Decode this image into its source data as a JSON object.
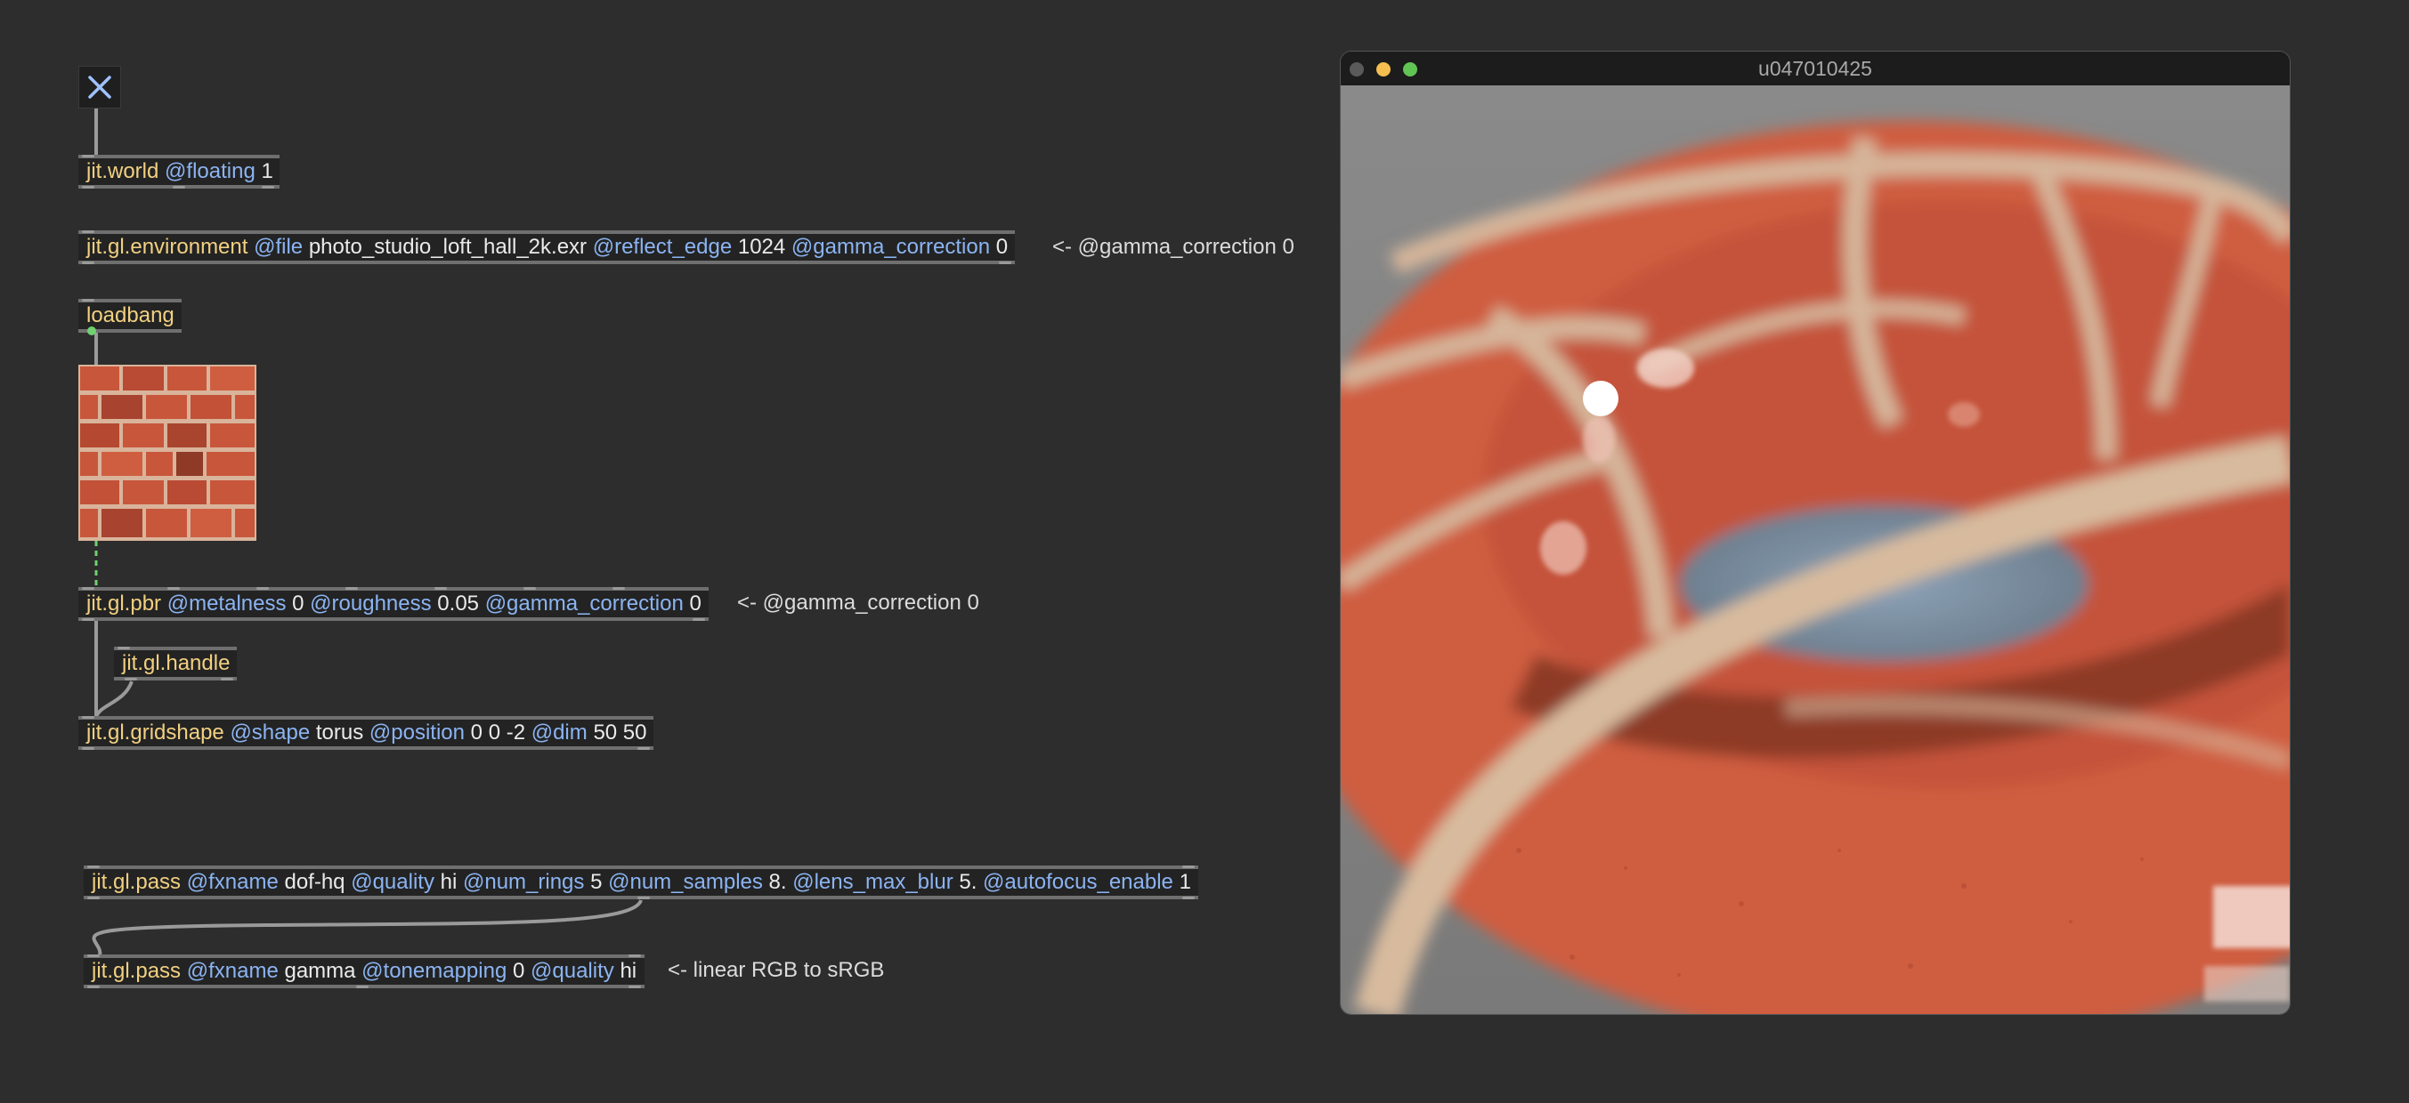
{
  "patcher": {
    "toggle_icon": "close-x-icon",
    "world": {
      "cls": "jit.world",
      "attr1": "@floating",
      "val1": "1"
    },
    "environment": {
      "cls": "jit.gl.environment",
      "attr1": "@file",
      "val1": "photo_studio_loft_hall_2k.exr",
      "attr2": "@reflect_edge",
      "val2": "1024",
      "attr3": "@gamma_correction",
      "val3": "0"
    },
    "environment_comment": "<- @gamma_correction 0",
    "loadbang": {
      "cls": "loadbang"
    },
    "texture_image": "brick-texture-image",
    "pbr": {
      "cls": "jit.gl.pbr",
      "attr1": "@metalness",
      "val1": "0",
      "attr2": "@roughness",
      "val2": "0.05",
      "attr3": "@gamma_correction",
      "val3": "0"
    },
    "pbr_comment": "<- @gamma_correction 0",
    "handle": {
      "cls": "jit.gl.handle"
    },
    "gridshape": {
      "cls": "jit.gl.gridshape",
      "attr1": "@shape",
      "val1": "torus",
      "attr2": "@position",
      "val2": "0 0 -2",
      "attr3": "@dim",
      "val3": "50 50"
    },
    "pass_dof": {
      "cls": "jit.gl.pass",
      "attr1": "@fxname",
      "val1": "dof-hq",
      "attr2": "@quality",
      "val2": "hi",
      "attr3": "@num_rings",
      "val3": "5",
      "attr4": "@num_samples",
      "val4": "8.",
      "attr5": "@lens_max_blur",
      "val5": "5.",
      "attr6": "@autofocus_enable",
      "val6": "1"
    },
    "pass_gamma": {
      "cls": "jit.gl.pass",
      "attr1": "@fxname",
      "val1": "gamma",
      "attr2": "@tonemapping",
      "val2": "0",
      "attr3": "@quality",
      "val3": "hi"
    },
    "pass_gamma_comment": "<- linear RGB to sRGB"
  },
  "render_window": {
    "title": "u047010425",
    "traffic_colors": [
      "#5a5a5a",
      "#f5bf4f",
      "#61c554"
    ],
    "render_content": "red-brick-torus-render"
  },
  "colors": {
    "background": "#2d2d2d",
    "object_class": "#f2d081",
    "attribute": "#8bb4f2",
    "value": "#eaeaea",
    "comment": "#dcdcdc"
  }
}
